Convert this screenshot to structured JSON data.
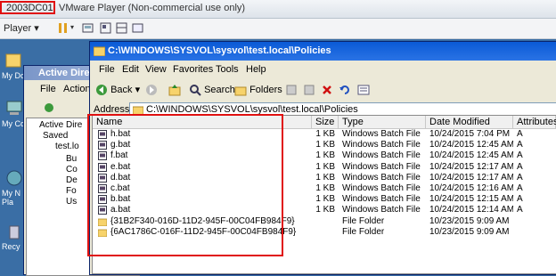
{
  "vm": {
    "host_label": "2003DC01",
    "app_title": "VMware Player (Non-commercial use only)",
    "player_menu": "Player"
  },
  "desktop": {
    "icons": [
      {
        "label": "My Do"
      },
      {
        "label": "My Co"
      },
      {
        "label": "My N Pla"
      },
      {
        "label": "Recy"
      }
    ]
  },
  "ad": {
    "title": "Active Direc",
    "menu": [
      "File",
      "Action"
    ],
    "tree": [
      "Active Dire",
      "Saved",
      "test.lo",
      "Bu",
      "Co",
      "De",
      "Fo",
      "Us"
    ]
  },
  "explorer": {
    "title": "C:\\WINDOWS\\SYSVOL\\sysvol\\test.local\\Policies",
    "menu": [
      "File",
      "Edit",
      "View",
      "Favorites",
      "Tools",
      "Help"
    ],
    "toolbar": {
      "back": "Back",
      "search": "Search",
      "folders": "Folders"
    },
    "address_label": "Address",
    "address_value": "C:\\WINDOWS\\SYSVOL\\sysvol\\test.local\\Policies",
    "columns": [
      "Name",
      "Size",
      "Type",
      "Date Modified",
      "Attributes"
    ],
    "rows": [
      {
        "name": "h.bat",
        "size": "1 KB",
        "type": "Windows Batch File",
        "date": "10/24/2015 7:04 PM",
        "attr": "A",
        "kind": "bat"
      },
      {
        "name": "g.bat",
        "size": "1 KB",
        "type": "Windows Batch File",
        "date": "10/24/2015 12:45 AM",
        "attr": "A",
        "kind": "bat"
      },
      {
        "name": "f.bat",
        "size": "1 KB",
        "type": "Windows Batch File",
        "date": "10/24/2015 12:45 AM",
        "attr": "A",
        "kind": "bat"
      },
      {
        "name": "e.bat",
        "size": "1 KB",
        "type": "Windows Batch File",
        "date": "10/24/2015 12:17 AM",
        "attr": "A",
        "kind": "bat"
      },
      {
        "name": "d.bat",
        "size": "1 KB",
        "type": "Windows Batch File",
        "date": "10/24/2015 12:17 AM",
        "attr": "A",
        "kind": "bat"
      },
      {
        "name": "c.bat",
        "size": "1 KB",
        "type": "Windows Batch File",
        "date": "10/24/2015 12:16 AM",
        "attr": "A",
        "kind": "bat"
      },
      {
        "name": "b.bat",
        "size": "1 KB",
        "type": "Windows Batch File",
        "date": "10/24/2015 12:15 AM",
        "attr": "A",
        "kind": "bat"
      },
      {
        "name": "a.bat",
        "size": "1 KB",
        "type": "Windows Batch File",
        "date": "10/24/2015 12:14 AM",
        "attr": "A",
        "kind": "bat"
      },
      {
        "name": "{31B2F340-016D-11D2-945F-00C04FB984F9}",
        "size": "",
        "type": "File Folder",
        "date": "10/23/2015 9:09 AM",
        "attr": "",
        "kind": "folder"
      },
      {
        "name": "{6AC1786C-016F-11D2-945F-00C04FB984F9}",
        "size": "",
        "type": "File Folder",
        "date": "10/23/2015 9:09 AM",
        "attr": "",
        "kind": "folder"
      }
    ]
  },
  "colors": {
    "highlight": "#e01010",
    "xp_blue": "#0a5ad6",
    "desktop": "#3a6ea5"
  }
}
